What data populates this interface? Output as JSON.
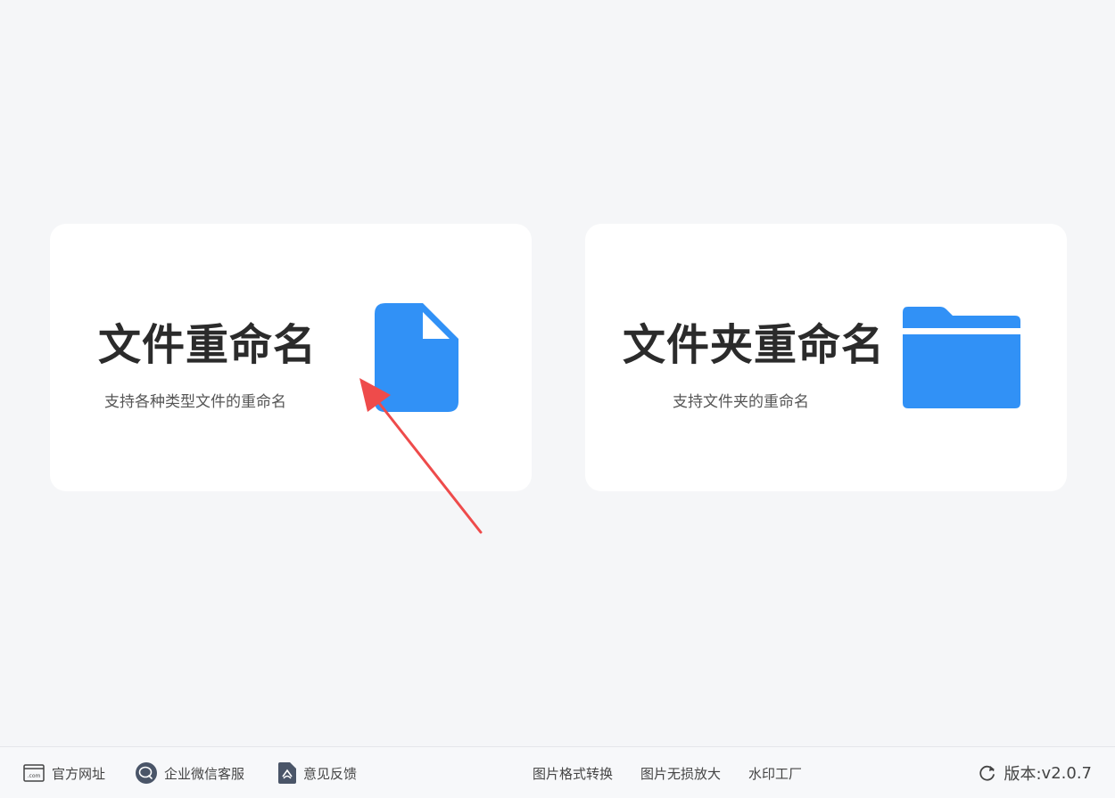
{
  "cards": [
    {
      "title": "文件重命名",
      "description": "支持各种类型文件的重命名",
      "icon": "file-icon"
    },
    {
      "title": "文件夹重命名",
      "description": "支持文件夹的重命名",
      "icon": "folder-icon"
    }
  ],
  "footer": {
    "website": {
      "label": "官方网址",
      "icon": "website-icon"
    },
    "wechat": {
      "label": "企业微信客服",
      "icon": "wechat-icon"
    },
    "feedback": {
      "label": "意见反馈",
      "icon": "feedback-icon"
    },
    "image_convert": "图片格式转换",
    "image_upscale": "图片无损放大",
    "watermark": "水印工厂",
    "version_label": "版本:",
    "version": "v2.0.7",
    "version_icon": "refresh-icon"
  },
  "colors": {
    "background": "#f5f6f8",
    "card": "#ffffff",
    "accent_blue": "#3191f6",
    "annotation_red": "#ee4b4b"
  }
}
